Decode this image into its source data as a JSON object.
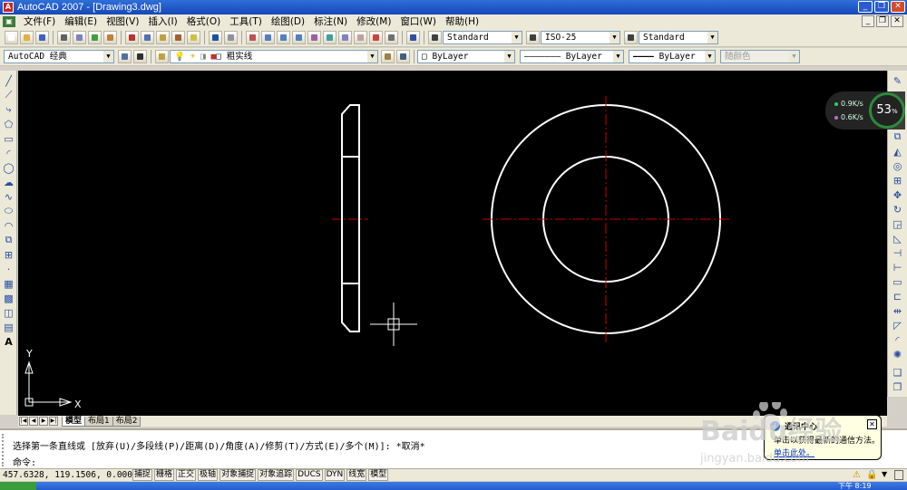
{
  "window": {
    "title": "AutoCAD 2007 - [Drawing3.dwg]",
    "app_icon": "autocad-icon"
  },
  "menubar": {
    "items": [
      "文件(F)",
      "编辑(E)",
      "视图(V)",
      "插入(I)",
      "格式(O)",
      "工具(T)",
      "绘图(D)",
      "标注(N)",
      "修改(M)",
      "窗口(W)",
      "帮助(H)"
    ]
  },
  "toolbar_standard": {
    "text_style": "Standard",
    "dim_style": "ISO-25",
    "table_style": "Standard"
  },
  "toolbar_layers": {
    "workspace": "AutoCAD 经典",
    "layer": "粗实线",
    "color": "ByLayer",
    "linetype": "ByLayer",
    "lineweight": "ByLayer",
    "plotstyle": "随颜色"
  },
  "network_widget": {
    "upload": "0.9K/s",
    "download": "0.6K/s",
    "percent": "53",
    "percent_unit": "%"
  },
  "ucs": {
    "x_label": "X",
    "y_label": "Y"
  },
  "layout_tabs": [
    "模型",
    "布局1",
    "布局2"
  ],
  "command": {
    "history": "选择第一条直线或 [放弃(U)/多段线(P)/距离(D)/角度(A)/修剪(T)/方式(E)/多个(M)]:  *取消*",
    "prompt": "命令:"
  },
  "status": {
    "coords": "457.6328, 119.1506, 0.0000",
    "toggles": [
      "捕捉",
      "栅格",
      "正交",
      "极轴",
      "对象捕捉",
      "对象追踪",
      "DUCS",
      "DYN",
      "线宽",
      "模型"
    ]
  },
  "balloon": {
    "title": "通讯中心",
    "body": "单击以获得最新的通信方法。",
    "link": "单击此处。"
  },
  "taskbar": {
    "time": "下午 8:19"
  },
  "watermark": {
    "text": "Baidu经验",
    "subtext": "jingyan.baidu.com"
  },
  "colors": {
    "canvas": "#000000",
    "geometry": "#ffffff",
    "centerline": "#cc0000",
    "title_bar": "#1f56c8"
  }
}
